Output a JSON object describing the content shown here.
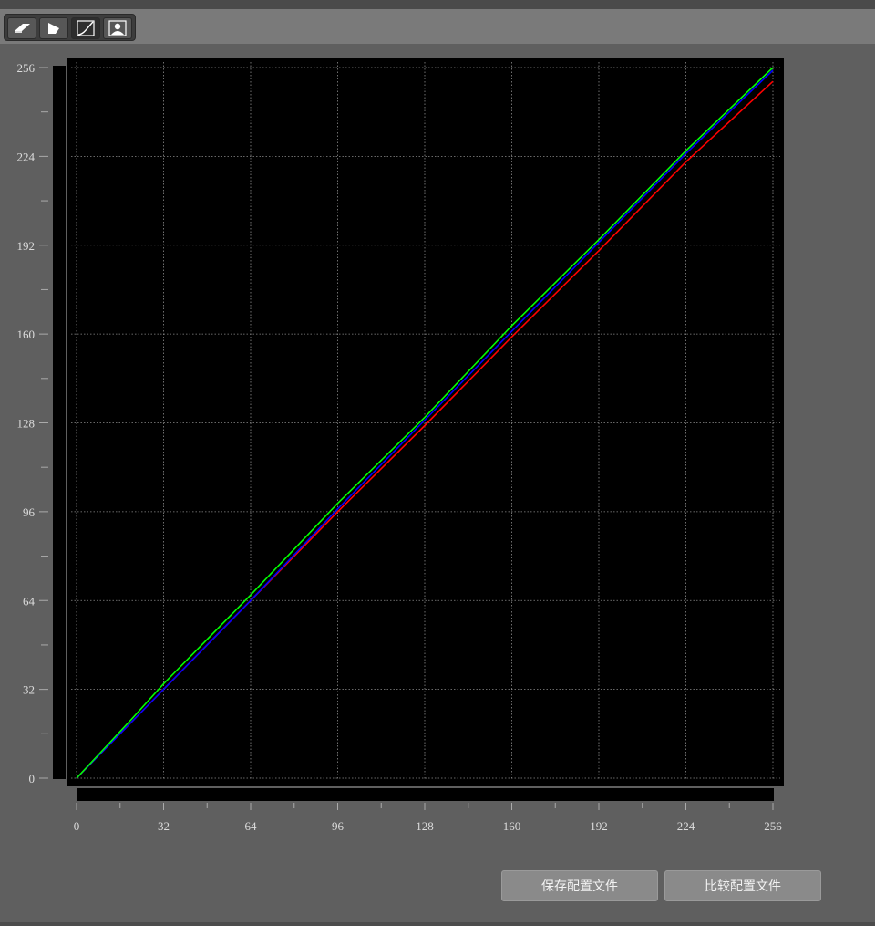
{
  "toolbar": {
    "tools": [
      {
        "icon": "eraser-icon"
      },
      {
        "icon": "tone-shape-icon"
      },
      {
        "icon": "curve-icon"
      },
      {
        "icon": "portrait-icon"
      }
    ]
  },
  "chart_data": {
    "type": "line",
    "title": "",
    "xlabel": "",
    "ylabel": "",
    "xlim": [
      0,
      256
    ],
    "ylim": [
      0,
      256
    ],
    "xticks": [
      0,
      32,
      64,
      96,
      128,
      160,
      192,
      224,
      256
    ],
    "yticks": [
      0,
      32,
      64,
      96,
      128,
      160,
      192,
      224,
      256
    ],
    "grid": true,
    "legend": "none",
    "series": [
      {
        "color": "#ff0000",
        "x": [
          0,
          32,
          64,
          96,
          128,
          160,
          192,
          224,
          256
        ],
        "y": [
          0,
          32,
          64,
          96,
          127,
          159,
          190,
          222,
          251
        ]
      },
      {
        "color": "#0000ff",
        "x": [
          0,
          32,
          64,
          96,
          128,
          160,
          192,
          224,
          256
        ],
        "y": [
          0,
          32,
          64,
          97,
          129,
          161,
          193,
          225,
          255
        ]
      },
      {
        "color": "#00ff00",
        "x": [
          0,
          20,
          32,
          64,
          96,
          128,
          160,
          192,
          224,
          256
        ],
        "y": [
          0,
          21,
          34,
          66,
          99,
          130,
          163,
          194,
          226,
          256
        ]
      }
    ]
  },
  "buttons": {
    "save": "保存配置文件",
    "compare": "比较配置文件"
  }
}
